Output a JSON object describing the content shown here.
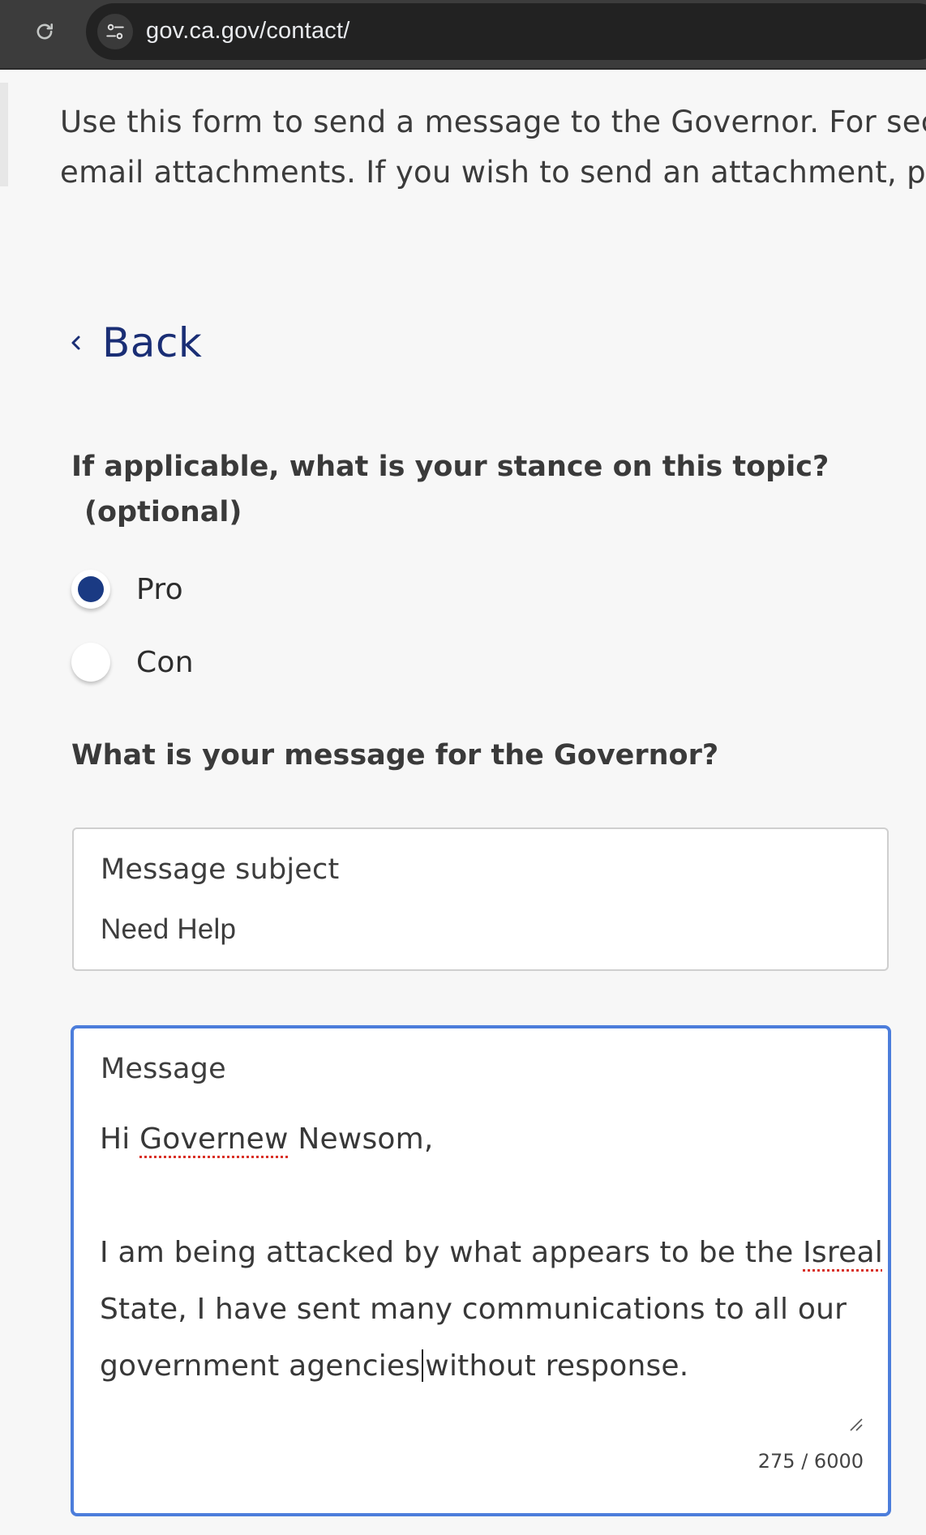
{
  "browser": {
    "url": "gov.ca.gov/contact/",
    "reload_icon": "reload-icon",
    "site_info_icon": "tune-icon"
  },
  "intro": {
    "line1": "Use this form to send a message to the Governor. For secu",
    "line2": "email attachments. If you wish to send an attachment, ple"
  },
  "back": {
    "label": "Back",
    "icon": "chevron-left-icon"
  },
  "stance": {
    "question": "If applicable, what is your stance on this topic?",
    "optional": "(optional)",
    "options": [
      {
        "label": "Pro",
        "selected": true
      },
      {
        "label": "Con",
        "selected": false
      }
    ]
  },
  "message_section": {
    "question": "What is your message for the Governor?",
    "subject": {
      "label": "Message subject",
      "value": "Need Help"
    },
    "message": {
      "label": "Message",
      "greeting_prefix": "Hi ",
      "greeting_misspelled": "Governew",
      "greeting_suffix": " Newsom,",
      "line3_prefix": "I am being attacked by what appears to be the ",
      "line3_misspelled": "Isreal",
      "line4": "State, I have sent many communications to all our",
      "line5_before_caret": "government agencies",
      "line5_after_caret": "without response.",
      "char_count": "275 / 6000"
    }
  },
  "colors": {
    "link": "#1a2e75",
    "radio_selected": "#1a3a83",
    "focus_border": "#4c7ddb",
    "spellcheck": "#d93025"
  }
}
